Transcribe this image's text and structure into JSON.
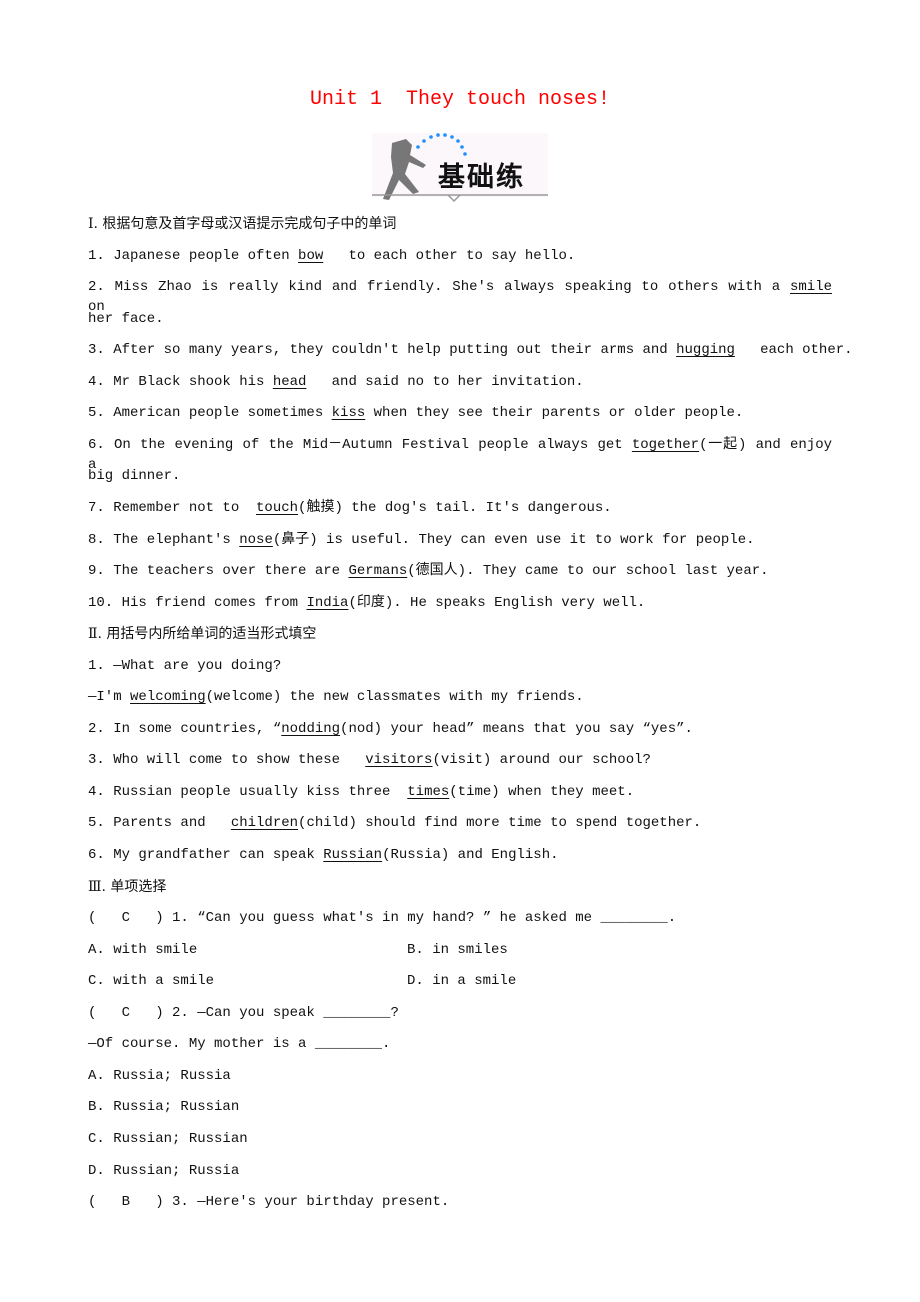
{
  "title": "Unit 1  They touch noses!",
  "logo": {
    "text": "基础练",
    "accent": "#1e90ff",
    "figure": "#777777"
  },
  "colors": {
    "title": "#ff0000"
  },
  "lines": [
    {
      "head": true,
      "parts": [
        {
          "t": "Ⅰ. 根据句意及首字母或汉语提示完成句子中的单词"
        }
      ]
    },
    {
      "parts": [
        {
          "t": "1. Japanese people often "
        },
        {
          "t": "bow",
          "u": true
        },
        {
          "t": "   to each other to say hello."
        }
      ]
    },
    {
      "just": true,
      "parts": [
        {
          "t": "2. Miss Zhao is really kind and friendly. She's always speaking to others with a "
        },
        {
          "t": "smile",
          "u": true
        },
        {
          "t": "  on"
        }
      ]
    },
    {
      "parts": [
        {
          "t": "her face."
        }
      ]
    },
    {
      "parts": [
        {
          "t": "3. After so many years, they couldn't help putting out their arms and "
        },
        {
          "t": "hugging",
          "u": true
        },
        {
          "t": "   each other."
        }
      ]
    },
    {
      "parts": [
        {
          "t": "4. Mr Black shook his "
        },
        {
          "t": "head",
          "u": true
        },
        {
          "t": "   and said no to her invitation."
        }
      ]
    },
    {
      "parts": [
        {
          "t": "5. American people sometimes "
        },
        {
          "t": "kiss",
          "u": true
        },
        {
          "t": " when they see their parents or older people."
        }
      ]
    },
    {
      "just": true,
      "parts": [
        {
          "t": "6. On the evening of the Mid－Autumn Festival people always get "
        },
        {
          "t": "together",
          "u": true
        },
        {
          "t": "(一起) and enjoy a"
        }
      ]
    },
    {
      "parts": [
        {
          "t": "big dinner."
        }
      ]
    },
    {
      "parts": [
        {
          "t": "7. Remember not to  "
        },
        {
          "t": "touch",
          "u": true
        },
        {
          "t": "(触摸) the dog's tail. It's dangerous."
        }
      ]
    },
    {
      "parts": [
        {
          "t": "8. The elephant's "
        },
        {
          "t": "nose",
          "u": true
        },
        {
          "t": "(鼻子) is useful. They can even use it to work for people."
        }
      ]
    },
    {
      "parts": [
        {
          "t": "9. The teachers over there are "
        },
        {
          "t": "Germans",
          "u": true
        },
        {
          "t": "(德国人). They came to our school last year."
        }
      ]
    },
    {
      "parts": [
        {
          "t": "10. His friend comes from "
        },
        {
          "t": "India",
          "u": true
        },
        {
          "t": "(印度). He speaks English very well."
        }
      ]
    },
    {
      "head": true,
      "parts": [
        {
          "t": "Ⅱ. 用括号内所给单词的适当形式填空"
        }
      ]
    },
    {
      "parts": [
        {
          "t": "1. —What are you doing?"
        }
      ]
    },
    {
      "parts": [
        {
          "t": "—I'm "
        },
        {
          "t": "welcoming",
          "u": true
        },
        {
          "t": "(welcome) the new classmates with my friends."
        }
      ]
    },
    {
      "parts": [
        {
          "t": "2. In some countries, “"
        },
        {
          "t": "nodding",
          "u": true
        },
        {
          "t": "(nod) your head” means that you say “yes”."
        }
      ]
    },
    {
      "parts": [
        {
          "t": "3. Who will come to show these   "
        },
        {
          "t": "visitors",
          "u": true
        },
        {
          "t": "(visit) around our school?"
        }
      ]
    },
    {
      "parts": [
        {
          "t": "4. Russian people usually kiss three  "
        },
        {
          "t": "times",
          "u": true
        },
        {
          "t": "(time) when they meet."
        }
      ]
    },
    {
      "parts": [
        {
          "t": "5. Parents and   "
        },
        {
          "t": "children",
          "u": true
        },
        {
          "t": "(child) should find more time to spend together."
        }
      ]
    },
    {
      "parts": [
        {
          "t": "6. My grandfather can speak "
        },
        {
          "t": "Russian",
          "u": true
        },
        {
          "t": "(Russia) and English."
        }
      ]
    },
    {
      "head": true,
      "parts": [
        {
          "t": "Ⅲ. 单项选择"
        }
      ]
    },
    {
      "parts": [
        {
          "t": "(   C   ) 1. “Can you guess what's in my hand? ” he asked me ________."
        }
      ]
    },
    {
      "parts": [
        {
          "t": "A. with smile"
        }
      ],
      "col2": "B. in smiles"
    },
    {
      "parts": [
        {
          "t": "C. with a smile"
        }
      ],
      "col2": "D. in a smile"
    },
    {
      "parts": [
        {
          "t": "(   C   ) 2. —Can you speak ________?"
        }
      ]
    },
    {
      "parts": [
        {
          "t": "—Of course. My mother is a ________."
        }
      ]
    },
    {
      "parts": [
        {
          "t": "A. Russia; Russia"
        }
      ]
    },
    {
      "parts": [
        {
          "t": "B. Russia; Russian"
        }
      ]
    },
    {
      "parts": [
        {
          "t": "C. Russian; Russian"
        }
      ]
    },
    {
      "parts": [
        {
          "t": "D. Russian; Russia"
        }
      ]
    },
    {
      "parts": [
        {
          "t": "(   B   ) 3. —Here's your birthday present."
        }
      ]
    }
  ]
}
